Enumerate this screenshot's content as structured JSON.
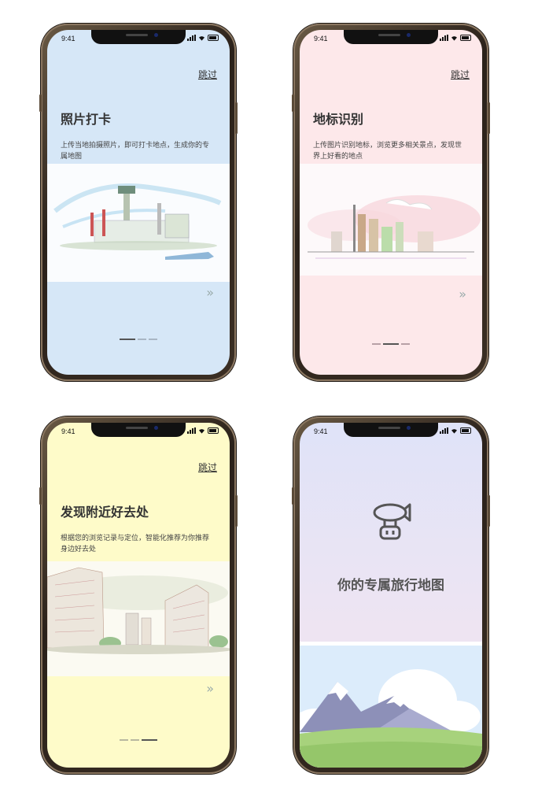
{
  "status_time": "9:41",
  "screens": [
    {
      "skip": "跳过",
      "title": "照片打卡",
      "desc": "上传当地拍摄照片，即可打卡地点，生成你的专属地图",
      "bg": "#d6e7f7",
      "accent": "#b8cde2"
    },
    {
      "skip": "跳过",
      "title": "地标识别",
      "desc": "上传图片识别地标，浏览更多相关景点，发现世界上好看的地点",
      "bg": "#fde8ea",
      "accent": "#f2c8cc"
    },
    {
      "skip": "跳过",
      "title": "发现附近好去处",
      "desc": "根据您的浏览记录与定位，智能化推荐为你推荐身边好去处",
      "bg": "#fefbc9",
      "accent": "#e8e2a0"
    },
    {
      "title": "你的专属旅行地图",
      "bg_top": "#e0e4f8",
      "bg_bottom": "#efe4f2"
    }
  ],
  "colors": {
    "text": "#333333",
    "indicator_active": "#555555",
    "indicator_inactive": "#a9b6c4"
  },
  "icons": [
    "airship-icon",
    "chevron-right-double-icon"
  ]
}
